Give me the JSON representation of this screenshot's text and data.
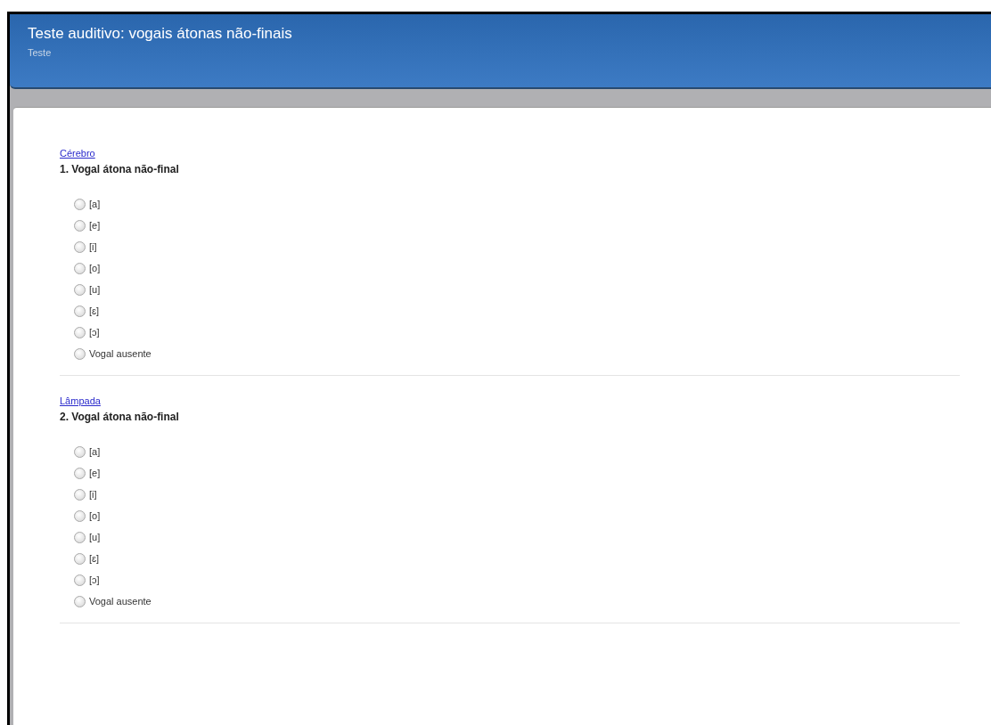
{
  "header": {
    "title": "Teste auditivo: vogais átonas não-finais",
    "subtitle": "Teste"
  },
  "questions": [
    {
      "word": "Cérebro",
      "title": "1. Vogal átona não-final",
      "options": [
        {
          "label": "[a]",
          "selected": false
        },
        {
          "label": "[e]",
          "selected": false
        },
        {
          "label": "[i]",
          "selected": false
        },
        {
          "label": "[o]",
          "selected": false
        },
        {
          "label": "[u]",
          "selected": false
        },
        {
          "label": "[ɛ]",
          "selected": false
        },
        {
          "label": "[ɔ]",
          "selected": false
        },
        {
          "label": "Vogal ausente",
          "selected": false
        }
      ]
    },
    {
      "word": "Lâmpada",
      "title": "2. Vogal átona não-final",
      "options": [
        {
          "label": "[a]",
          "selected": false
        },
        {
          "label": "[e]",
          "selected": false
        },
        {
          "label": "[i]",
          "selected": false
        },
        {
          "label": "[o]",
          "selected": false
        },
        {
          "label": "[u]",
          "selected": false
        },
        {
          "label": "[ɛ]",
          "selected": false
        },
        {
          "label": "[ɔ]",
          "selected": false
        },
        {
          "label": "Vogal ausente",
          "selected": false
        }
      ]
    }
  ]
}
